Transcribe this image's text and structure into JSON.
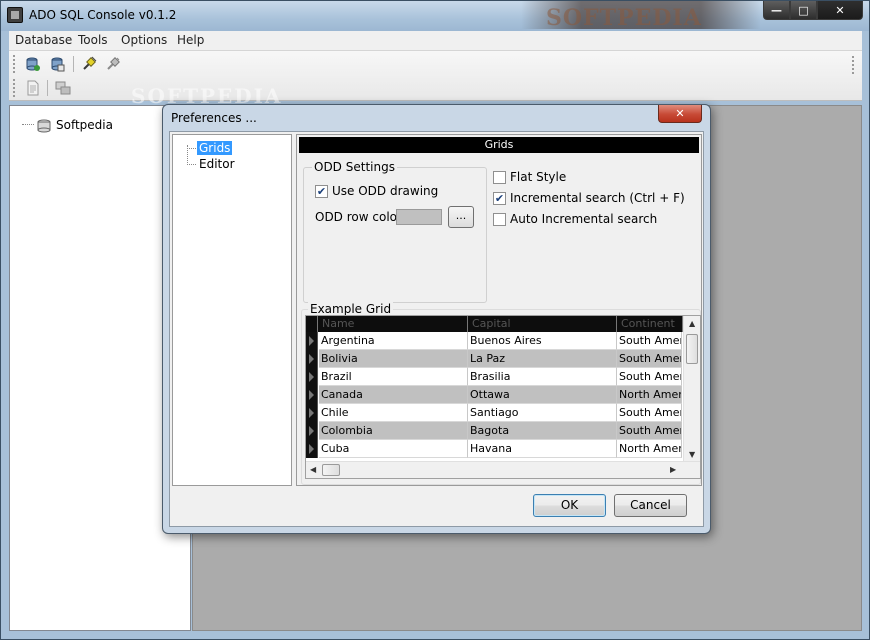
{
  "window": {
    "title": "ADO SQL Console v0.1.2",
    "watermark": "SOFTPEDIA",
    "controls": {
      "minimize": "—",
      "maximize": "□",
      "close": "✕"
    }
  },
  "menu": {
    "items": [
      "Database",
      "Tools",
      "Options",
      "Help"
    ]
  },
  "toolbar": {
    "row1_icons": [
      "connect-db-icon",
      "refresh-db-icon",
      "plug-connect-icon",
      "plug-disconnect-icon"
    ],
    "row2_icons": [
      "new-document-icon",
      "table-icon"
    ]
  },
  "explorer": {
    "root_label": "Softpedia"
  },
  "workspace_watermark": "SOFTPEDIA",
  "dialog": {
    "title": "Preferences ...",
    "close": "✕",
    "nav": [
      {
        "label": "Grids",
        "selected": true
      },
      {
        "label": "Editor",
        "selected": false
      }
    ],
    "section_header": "Grids",
    "odd_settings": {
      "title": "ODD Settings",
      "use_odd_drawing_label": "Use ODD drawing",
      "use_odd_drawing": true,
      "odd_row_color_label": "ODD row color :",
      "odd_row_color": "#c0c0c0",
      "browse_button": "..."
    },
    "options": {
      "flat_style_label": "Flat Style",
      "flat_style": false,
      "incremental_search_label": "Incremental search (Ctrl + F)",
      "incremental_search": true,
      "auto_incremental_label": "Auto Incremental search",
      "auto_incremental": false
    },
    "example_grid": {
      "title": "Example Grid",
      "columns": [
        "Name",
        "Capital",
        "Continent"
      ],
      "rows": [
        [
          "Argentina",
          "Buenos Aires",
          "South Americ"
        ],
        [
          "Bolivia",
          "La Paz",
          "South Americ"
        ],
        [
          "Brazil",
          "Brasilia",
          "South Americ"
        ],
        [
          "Canada",
          "Ottawa",
          "North America"
        ],
        [
          "Chile",
          "Santiago",
          "South Americ"
        ],
        [
          "Colombia",
          "Bagota",
          "South Americ"
        ],
        [
          "Cuba",
          "Havana",
          "North America"
        ]
      ]
    },
    "ok_label": "OK",
    "cancel_label": "Cancel"
  }
}
